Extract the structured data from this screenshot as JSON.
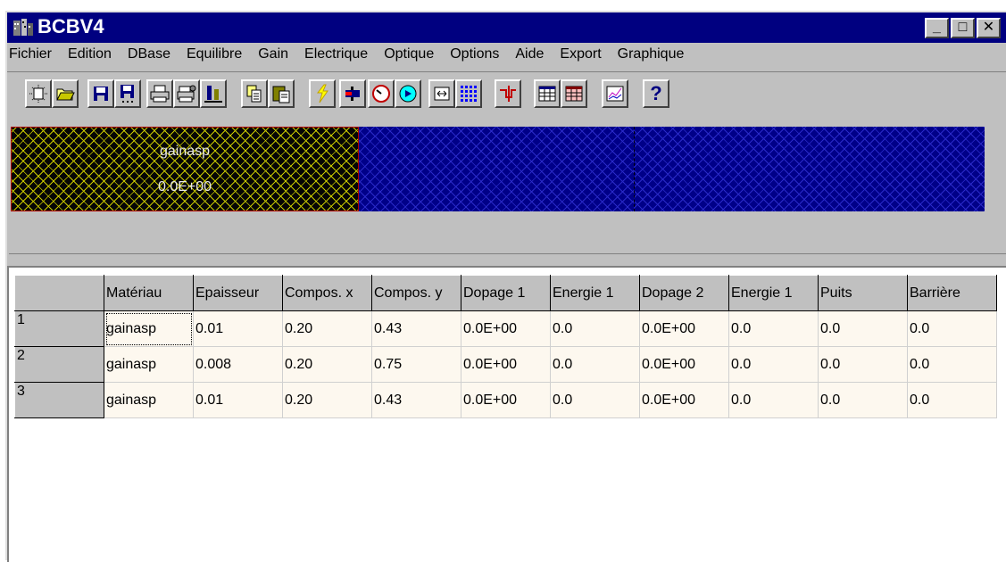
{
  "window": {
    "title": "BCBV4",
    "buttons": {
      "minimize": "_",
      "maximize": "□",
      "close": "✕"
    }
  },
  "menu": [
    {
      "label": "Fichier"
    },
    {
      "label": "Edition"
    },
    {
      "label": "DBase"
    },
    {
      "label": "Equilibre"
    },
    {
      "label": "Gain"
    },
    {
      "label": "Electrique"
    },
    {
      "label": "Optique"
    },
    {
      "label": "Options"
    },
    {
      "label": "Aide"
    },
    {
      "label": "Export"
    },
    {
      "label": "Graphique"
    }
  ],
  "toolbar": [
    {
      "icon": "new-icon"
    },
    {
      "icon": "open-folder-icon"
    },
    {
      "icon": "save-icon"
    },
    {
      "icon": "save-as-icon"
    },
    {
      "icon": "print-icon"
    },
    {
      "icon": "print-setup-icon"
    },
    {
      "icon": "chart-export-icon"
    },
    {
      "icon": "copy-icon"
    },
    {
      "icon": "paste-icon"
    },
    {
      "icon": "lightning-icon"
    },
    {
      "icon": "layer-icon"
    },
    {
      "icon": "gauge-icon"
    },
    {
      "icon": "circle-play-icon"
    },
    {
      "icon": "resize-icon"
    },
    {
      "icon": "dot-grid-icon"
    },
    {
      "icon": "band-diagram-icon"
    },
    {
      "icon": "table-icon"
    },
    {
      "icon": "table-colored-icon"
    },
    {
      "icon": "graph-icon"
    },
    {
      "icon": "help-icon",
      "label": "?"
    }
  ],
  "layers": [
    {
      "name": "gainasp",
      "value": "0.0E+00",
      "color": "#c8c800"
    },
    {
      "name": "",
      "value": "",
      "color": "#2a2ac8"
    },
    {
      "name": "",
      "value": "",
      "color": "#2a2ac8"
    }
  ],
  "grid": {
    "headers": [
      "Matériau",
      "Epaisseur",
      "Compos. x",
      "Compos. y",
      "Dopage 1",
      "Energie 1",
      "Dopage 2",
      "Energie 1",
      "Puits",
      "Barrière"
    ],
    "rows": [
      {
        "num": "1",
        "cells": [
          "gainasp",
          "0.01",
          "0.20",
          "0.43",
          "0.0E+00",
          "0.0",
          "0.0E+00",
          "0.0",
          "0.0",
          "0.0"
        ]
      },
      {
        "num": "2",
        "cells": [
          "gainasp",
          "0.008",
          "0.20",
          "0.75",
          "0.0E+00",
          "0.0",
          "0.0E+00",
          "0.0",
          "0.0",
          "0.0"
        ]
      },
      {
        "num": "3",
        "cells": [
          "gainasp",
          "0.01",
          "0.20",
          "0.43",
          "0.0E+00",
          "0.0",
          "0.0E+00",
          "0.0",
          "0.0",
          "0.0"
        ]
      }
    ]
  },
  "colors": {
    "titlebar": "#000080",
    "face": "#c0c0c0",
    "cell_bg": "#fdf8ef"
  }
}
